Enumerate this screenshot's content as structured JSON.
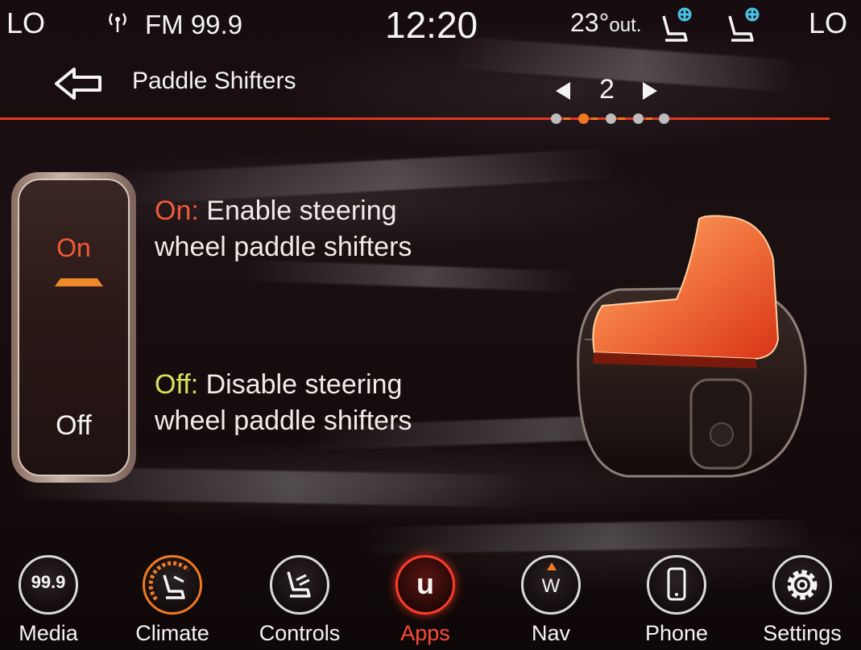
{
  "status": {
    "left_temp": "LO",
    "radio": "FM 99.9",
    "clock": "12:20",
    "outside_temp": "23°",
    "outside_suffix": "out.",
    "right_temp": "LO"
  },
  "header": {
    "title": "Paddle Shifters",
    "page": "2",
    "page_dots": 5,
    "active_dot": 2
  },
  "toggle": {
    "on_label": "On",
    "off_label": "Off"
  },
  "descriptions": {
    "on_keyword": "On:",
    "on_line1": "Enable steering",
    "on_line2": "wheel paddle shifters",
    "off_keyword": "Off:",
    "off_line1": "Disable steering",
    "off_line2": "wheel paddle shifters"
  },
  "nav": {
    "items": [
      {
        "label": "Media",
        "icon": "radio-9-9-icon",
        "badge": "99.9"
      },
      {
        "label": "Climate",
        "icon": "climate-seat-icon"
      },
      {
        "label": "Controls",
        "icon": "controls-seat-icon"
      },
      {
        "label": "Apps",
        "icon": "uconnect-apps-icon",
        "badge": "u",
        "active": true
      },
      {
        "label": "Nav",
        "icon": "compass-icon",
        "badge": "W"
      },
      {
        "label": "Phone",
        "icon": "phone-icon"
      },
      {
        "label": "Settings",
        "icon": "gear-icon"
      }
    ]
  },
  "colors": {
    "accent_orange": "#f07a22",
    "accent_red": "#e2381f",
    "on_color": "#f25a3a",
    "off_color": "#d7e25a"
  }
}
